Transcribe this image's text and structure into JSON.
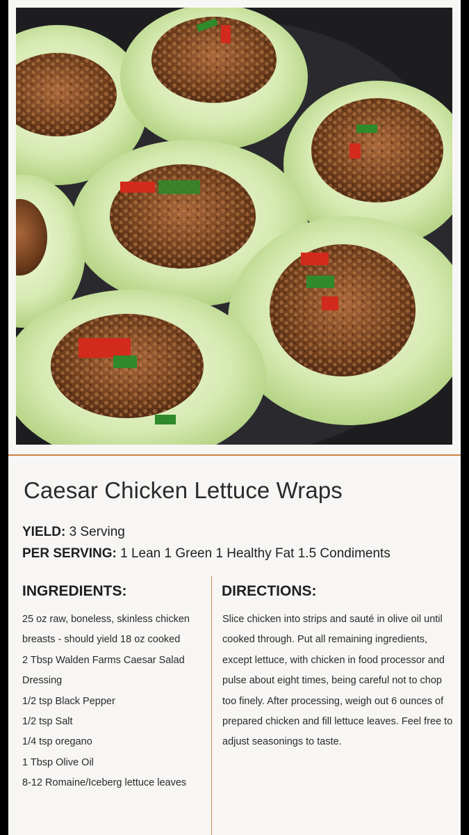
{
  "recipe": {
    "title": "Caesar Chicken Lettuce Wraps",
    "yield_label": "YIELD:",
    "yield_value": "3 Serving",
    "per_serving_label": "PER SERVING:",
    "per_serving_value": "1 Lean 1 Green 1 Healthy Fat 1.5 Condiments",
    "ingredients_heading": "INGREDIENTS:",
    "directions_heading": "DIRECTIONS:",
    "ingredients": [
      "25 oz raw, boneless, skinless chicken breasts - should yield 18 oz cooked",
      "2 Tbsp Walden Farms Caesar Salad Dressing",
      "1/2 tsp Black Pepper",
      "1/2 tsp Salt",
      "1/4 tsp oregano",
      "1 Tbsp Olive Oil",
      "8-12 Romaine/Iceberg lettuce leaves"
    ],
    "directions": "Slice chicken into strips and sauté in olive oil until cooked through. Put all remaining ingredients, except lettuce, with chicken in food processor and pulse about eight times, being careful not to chop too finely. After processing, weigh out 6 ounces of prepared chicken and fill lettuce leaves. Feel free to adjust seasonings to taste."
  },
  "colors": {
    "accent_rule": "#c98545",
    "card_background": "#f7f6f4",
    "lettuce": "#d6e8b0",
    "filling": "#7a4a24"
  },
  "photo": {
    "subject_icon": "lettuce-wraps-photo"
  }
}
